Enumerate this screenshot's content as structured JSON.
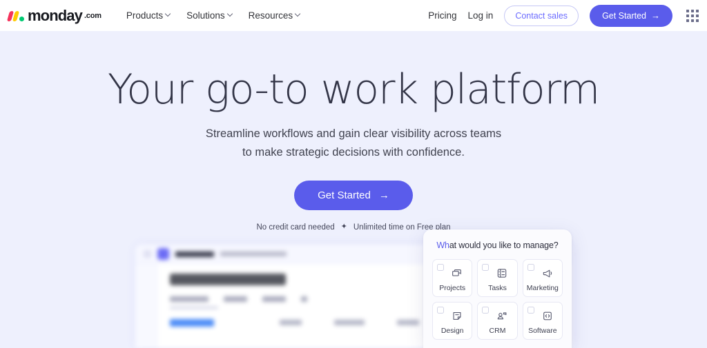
{
  "nav": {
    "logo": {
      "word": "monday",
      "suffix": ".com"
    },
    "links": [
      {
        "label": "Products",
        "caret": "chevron-down-icon"
      },
      {
        "label": "Solutions",
        "caret": "chevron-down-icon"
      },
      {
        "label": "Resources",
        "caret": "chevron-down-icon"
      }
    ],
    "pricing": "Pricing",
    "login": "Log in",
    "contact_sales": "Contact sales",
    "get_started": "Get Started",
    "get_started_arrow": "→",
    "apps_icon": "grid-apps-icon"
  },
  "hero": {
    "headline": "Your go-to work platform",
    "subhead_line1": "Streamline workflows and gain clear visibility across teams",
    "subhead_line2": "to make strategic decisions with confidence.",
    "cta_label": "Get Started",
    "cta_arrow": "→",
    "fineprint_left": "No credit card needed",
    "fineprint_sep": "✦",
    "fineprint_right": "Unlimited time on Free plan"
  },
  "modal": {
    "title_highlight": "Wh",
    "title_rest": "at would you like to manage?",
    "tiles": [
      {
        "label": "Projects",
        "icon": "boards-stack-icon"
      },
      {
        "label": "Tasks",
        "icon": "task-list-icon"
      },
      {
        "label": "Marketing",
        "icon": "megaphone-icon"
      },
      {
        "label": "Design",
        "icon": "design-note-icon"
      },
      {
        "label": "CRM",
        "icon": "crm-contacts-icon"
      },
      {
        "label": "Software",
        "icon": "code-brackets-icon"
      }
    ]
  },
  "mockup": {
    "brand": "monday",
    "brand_sub": "work management",
    "board_title": "Project planning",
    "tabs": [
      "Main table",
      "Kanban",
      "Gantt",
      "+"
    ],
    "group_name": "Planning",
    "columns": [
      "Owner",
      "Timeline",
      "Date",
      "Status"
    ]
  },
  "theme": {
    "page_bg": "#eef0fd",
    "nav_bg": "#ffffff",
    "accent": "#5a5ceb",
    "accent_soft": "#6c6cff",
    "text_dark": "#333547",
    "text_body": "#40424f",
    "logo_red": "#f5335b",
    "logo_yellow": "#ffcb00",
    "logo_green": "#00ca72"
  }
}
